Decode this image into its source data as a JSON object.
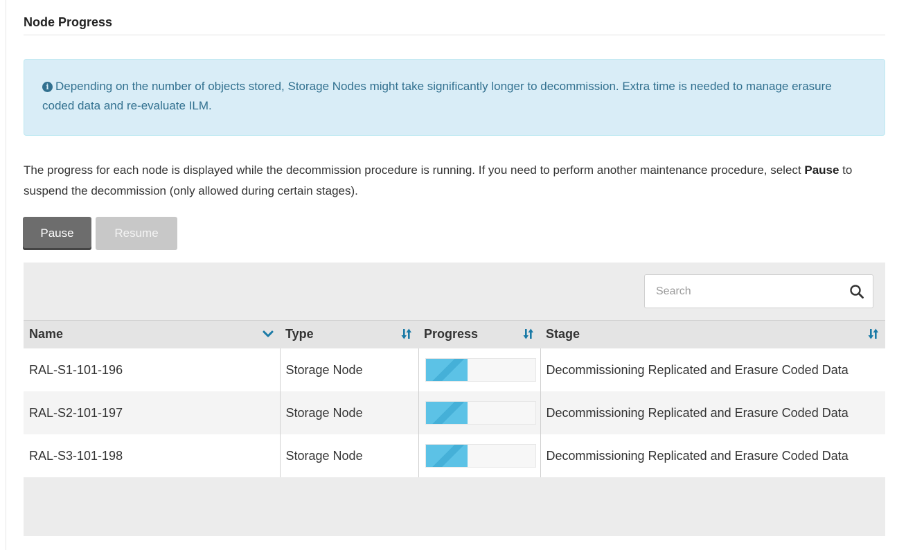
{
  "section": {
    "title": "Node Progress"
  },
  "alert": {
    "icon": "info-circle-icon",
    "text": "Depending on the number of objects stored, Storage Nodes might take significantly longer to decommission. Extra time is needed to manage erasure coded data and re-evaluate ILM."
  },
  "description": {
    "before": "The progress for each node is displayed while the decommission procedure is running. If you need to perform another maintenance procedure, select ",
    "bold": "Pause",
    "after": " to suspend the decommission (only allowed during certain stages)."
  },
  "buttons": {
    "pause": "Pause",
    "resume": "Resume"
  },
  "search": {
    "placeholder": "Search"
  },
  "table": {
    "columns": {
      "name": "Name",
      "type": "Type",
      "progress": "Progress",
      "stage": "Stage"
    },
    "rows": [
      {
        "name": "RAL-S1-101-196",
        "type": "Storage Node",
        "progress": 0.38,
        "stage": "Decommissioning Replicated and Erasure Coded Data"
      },
      {
        "name": "RAL-S2-101-197",
        "type": "Storage Node",
        "progress": 0.38,
        "stage": "Decommissioning Replicated and Erasure Coded Data"
      },
      {
        "name": "RAL-S3-101-198",
        "type": "Storage Node",
        "progress": 0.38,
        "stage": "Decommissioning Replicated and Erasure Coded Data"
      }
    ]
  },
  "colors": {
    "alert_bg": "#d9edf7",
    "alert_text": "#31708f",
    "progress_fill": "#5cc2e6",
    "sort_icon": "#1a7aa6"
  }
}
